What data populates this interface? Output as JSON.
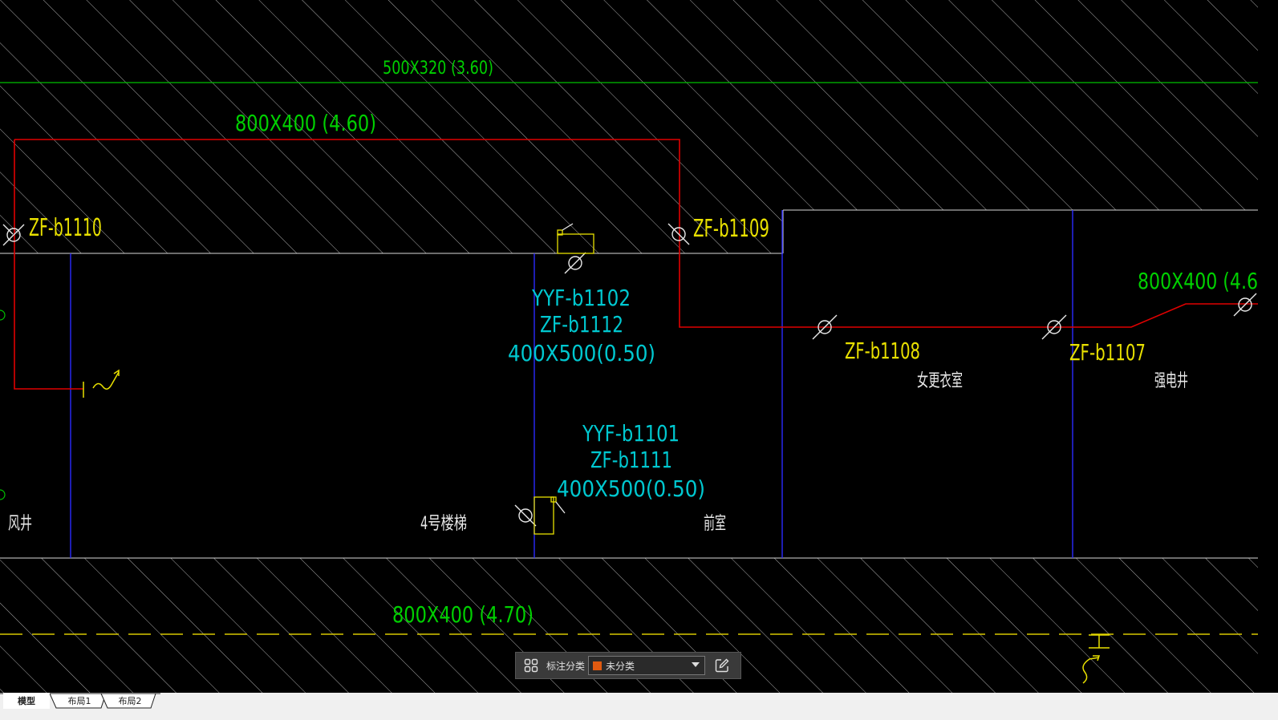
{
  "drawing": {
    "duct_labels": {
      "top_green": "500X320 (3.60)",
      "red_duct": "800X400 (4.60)",
      "right_duct": "800X400 (4.6",
      "bottom_duct": "800X400 (4.70)"
    },
    "damper_tags": {
      "b1110": "ZF-b1110",
      "b1109": "ZF-b1109",
      "b1108": "ZF-b1108",
      "b1107": "ZF-b1107"
    },
    "riser_1": {
      "line1": "YYF-b1102",
      "line2": "ZF-b1112",
      "line3": "400X500(0.50)"
    },
    "riser_2": {
      "line1": "YYF-b1101",
      "line2": "ZF-b1111",
      "line3": "400X500(0.50)"
    },
    "rooms": {
      "shaft": "风井",
      "stair": "4号楼梯",
      "anteroom": "前室",
      "locker": "女更衣室",
      "elec_shaft": "强电井"
    },
    "colors": {
      "background": "#000000",
      "hatch": "#d8d8d8",
      "wall": "#d8d8d8",
      "axis": "#2a2aff",
      "duct_red": "#e00000",
      "duct_green": "#00c000",
      "text_green": "#00d000",
      "text_yellow": "#e8e000",
      "text_cyan": "#00c8d0"
    }
  },
  "annotation_bar": {
    "label": "标注分类",
    "selected_value": "未分类",
    "swatch_color": "#e05a10",
    "icons": [
      "grid-icon",
      "chevron-down-icon",
      "edit-icon"
    ]
  },
  "tabs": [
    {
      "label": "模型",
      "active": true
    },
    {
      "label": "布局1",
      "active": false
    },
    {
      "label": "布局2",
      "active": false
    }
  ]
}
